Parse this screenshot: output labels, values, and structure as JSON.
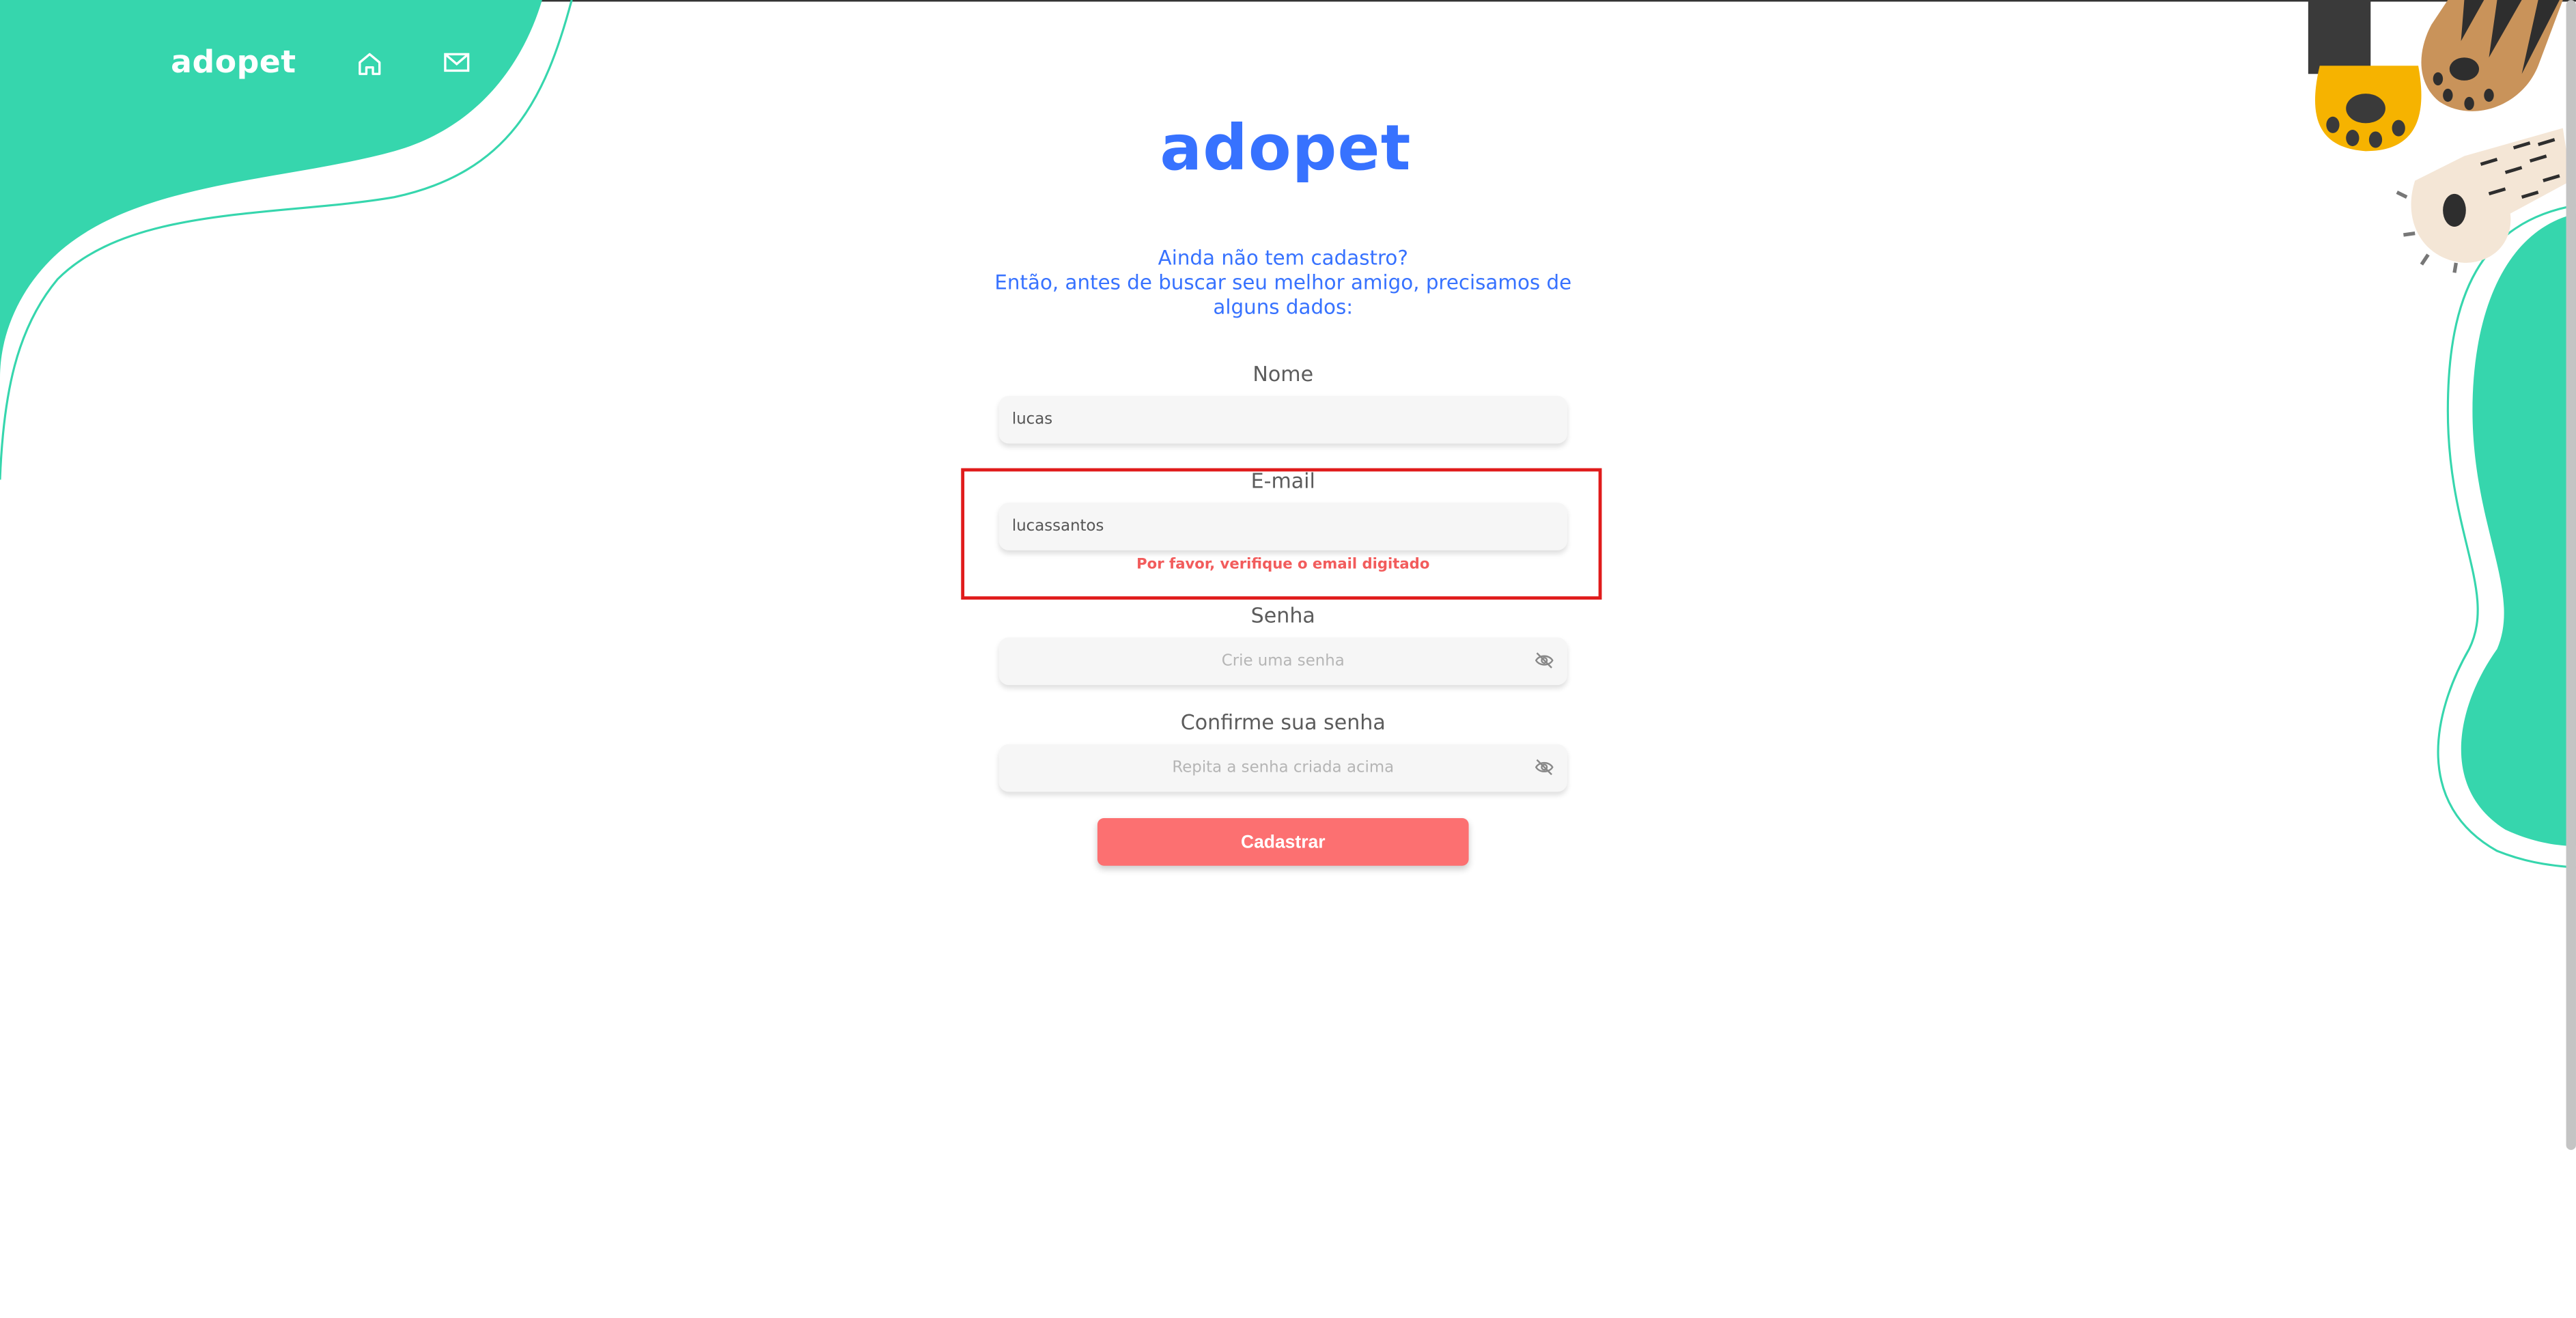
{
  "header": {
    "logo_text": "adopet",
    "nav": [
      {
        "icon": "home-icon"
      },
      {
        "icon": "mail-icon"
      }
    ]
  },
  "main": {
    "logo_text": "adopet",
    "intro_line1": "Ainda não tem cadastro?",
    "intro_line2": "Então, antes de buscar seu melhor amigo, precisamos de alguns dados:"
  },
  "form": {
    "name": {
      "label": "Nome",
      "value": "lucas"
    },
    "email": {
      "label": "E-mail",
      "value": "lucassantos",
      "error": "Por favor, verifique o email digitado"
    },
    "password": {
      "label": "Senha",
      "placeholder": "Crie uma senha"
    },
    "confirm": {
      "label": "Confirme sua senha",
      "placeholder": "Repita a senha criada acima"
    },
    "submit_label": "Cadastrar"
  },
  "colors": {
    "accent_green": "#36d6ad",
    "brand_blue": "#3772ff",
    "button_coral": "#fc7071",
    "error_red": "#f25c5c",
    "highlight_red": "#e01b1b"
  }
}
